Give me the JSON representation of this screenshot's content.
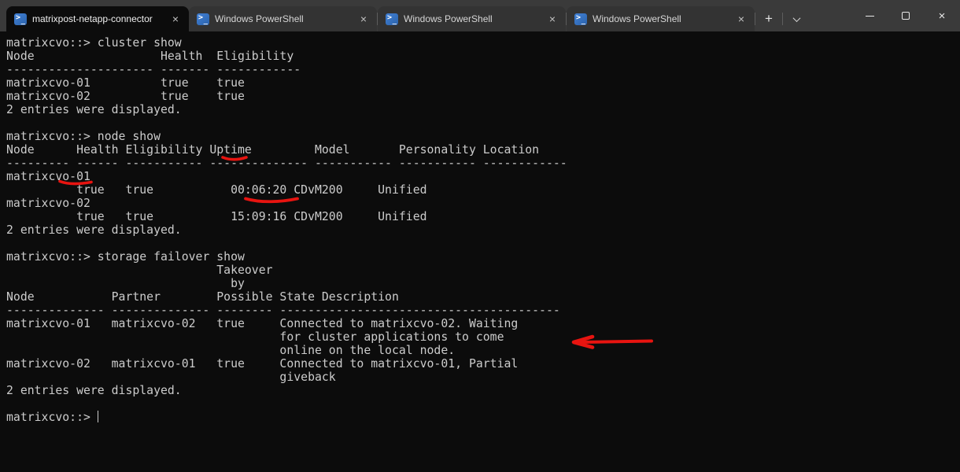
{
  "tab_bar": {
    "tabs": [
      {
        "title": "matrixpost-netapp-connector",
        "active": true
      },
      {
        "title": "Windows PowerShell",
        "active": false
      },
      {
        "title": "Windows PowerShell",
        "active": false
      },
      {
        "title": "Windows PowerShell",
        "active": false
      }
    ],
    "close_tab_glyph": "×",
    "new_tab_glyph": "+"
  },
  "window_controls": {
    "minimize": "minimize",
    "maximize": "maximize",
    "close_glyph": "×"
  },
  "terminal": {
    "background": "#0c0c0c",
    "foreground": "#cccccc",
    "prompt": "matrixcvo::> ",
    "lines": [
      "matrixcvo::> cluster show",
      "Node                  Health  Eligibility",
      "--------------------- ------- ------------",
      "matrixcvo-01          true    true",
      "matrixcvo-02          true    true",
      "2 entries were displayed.",
      "",
      "matrixcvo::> node show",
      "Node      Health Eligibility Uptime         Model       Personality Location",
      "--------- ------ ----------- -------------- ----------- ----------- ------------",
      "matrixcvo-01",
      "          true   true           00:06:20 CDvM200     Unified",
      "matrixcvo-02",
      "          true   true           15:09:16 CDvM200     Unified",
      "2 entries were displayed.",
      "",
      "matrixcvo::> storage failover show",
      "                              Takeover",
      "                                by",
      "Node           Partner        Possible State Description",
      "-------------- -------------- -------- ----------------------------------------",
      "matrixcvo-01   matrixcvo-02   true     Connected to matrixcvo-02. Waiting",
      "                                       for cluster applications to come",
      "                                       online on the local node.",
      "matrixcvo-02   matrixcvo-01   true     Connected to matrixcvo-01, Partial",
      "                                       giveback",
      "2 entries were displayed.",
      ""
    ]
  },
  "annotations": {
    "color": "#e81410",
    "items": [
      {
        "type": "underline",
        "target": "Uptime"
      },
      {
        "type": "underline",
        "target": "matrixcvo-01"
      },
      {
        "type": "underline",
        "target": "00:06:20"
      },
      {
        "type": "arrow",
        "target": "Connected to matrixcvo-02. Waiting for cluster applications to come online on the local node."
      }
    ]
  }
}
